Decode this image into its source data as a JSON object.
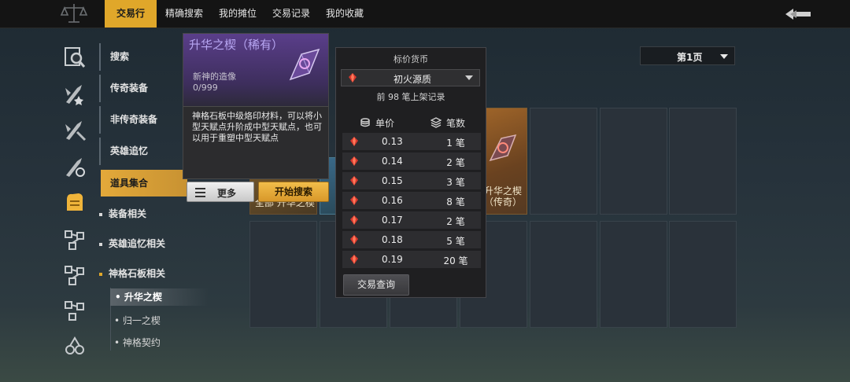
{
  "tabs": [
    {
      "label": "交易行",
      "active": true
    },
    {
      "label": "精确搜索",
      "active": false
    },
    {
      "label": "我的摊位",
      "active": false
    },
    {
      "label": "交易记录",
      "active": false
    },
    {
      "label": "我的收藏",
      "active": false
    }
  ],
  "sidebar_icons": [
    "search-icon",
    "legendary-gear-icon",
    "non-legendary-gear-icon",
    "hero-memory-icon",
    "item-collection-icon",
    "gear-related-icon",
    "memory-related-icon",
    "divine-tablet-icon",
    "misc-icon",
    "contract-icon"
  ],
  "categories": [
    {
      "label": "搜索",
      "active": false
    },
    {
      "label": "传奇装备",
      "active": false
    },
    {
      "label": "非传奇装备",
      "active": false
    },
    {
      "label": "英雄追忆",
      "active": false
    },
    {
      "label": "道具集合",
      "active": true
    }
  ],
  "subcategories": [
    {
      "label": "装备相关",
      "selected": false
    },
    {
      "label": "英雄追忆相关",
      "selected": false
    },
    {
      "label": "神格石板相关",
      "selected": true
    }
  ],
  "leaf_items": [
    {
      "label": "升华之楔",
      "active": true
    },
    {
      "label": "归一之楔",
      "active": false
    },
    {
      "label": "神格契约",
      "active": false
    }
  ],
  "page_selector": {
    "value": "第1页"
  },
  "item_card": {
    "title": "升华之楔（稀有）",
    "subtitle": "新神的造像",
    "count": "0/999",
    "description": "神格石板中级烙印材料，可以将小型天赋点升阶成中型天赋点，也可以用于重塑中型天赋点",
    "more_label": "更多",
    "search_label": "开始搜索"
  },
  "thumbnails": [
    {
      "label": "升华之楔（传奇）"
    },
    {
      "label": "全部 升华之楔"
    }
  ],
  "price_panel": {
    "header": "标价货币",
    "currency": "初火源质",
    "note": "前 98 笔上架记录",
    "col_price": "单价",
    "col_count": "笔数",
    "rows": [
      {
        "price": "0.13",
        "count": "1 笔"
      },
      {
        "price": "0.14",
        "count": "2 笔"
      },
      {
        "price": "0.15",
        "count": "3 笔"
      },
      {
        "price": "0.16",
        "count": "8 笔"
      },
      {
        "price": "0.17",
        "count": "2 笔"
      },
      {
        "price": "0.18",
        "count": "5 笔"
      },
      {
        "price": "0.19",
        "count": "20 笔"
      }
    ],
    "query_label": "交易查询"
  },
  "colors": {
    "accent": "#e0a72a",
    "rare_title": "#b7a6f2"
  }
}
